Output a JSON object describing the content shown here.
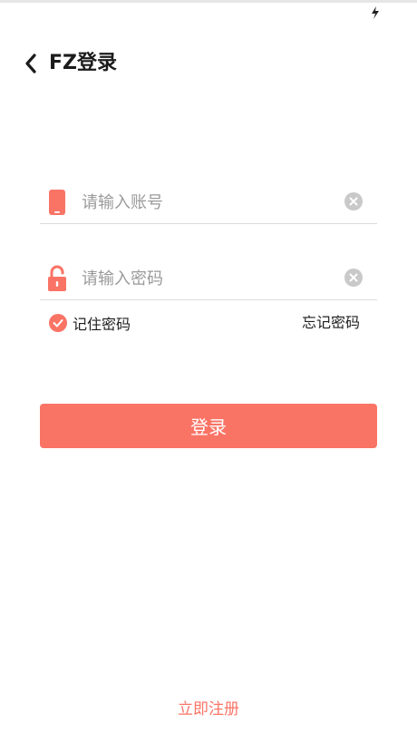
{
  "header": {
    "title": "FZ登录",
    "back_icon": "chevron-left-icon"
  },
  "status_bar": {
    "icon": "flash-icon"
  },
  "account_field": {
    "icon": "phone-icon",
    "placeholder": "请输入账号",
    "value": "",
    "clear_icon": "clear-icon"
  },
  "password_field": {
    "icon": "unlock-icon",
    "placeholder": "请输入密码",
    "value": "",
    "clear_icon": "clear-icon"
  },
  "remember": {
    "label": "记住密码",
    "checked": true
  },
  "forgot_label": "忘记密码",
  "login_label": "登录",
  "register_label": "立即注册",
  "colors": {
    "accent": "#fa7466",
    "divider": "#dcdcdc",
    "placeholder": "#9a9a9a",
    "clear_bg": "#c9c9c9"
  }
}
